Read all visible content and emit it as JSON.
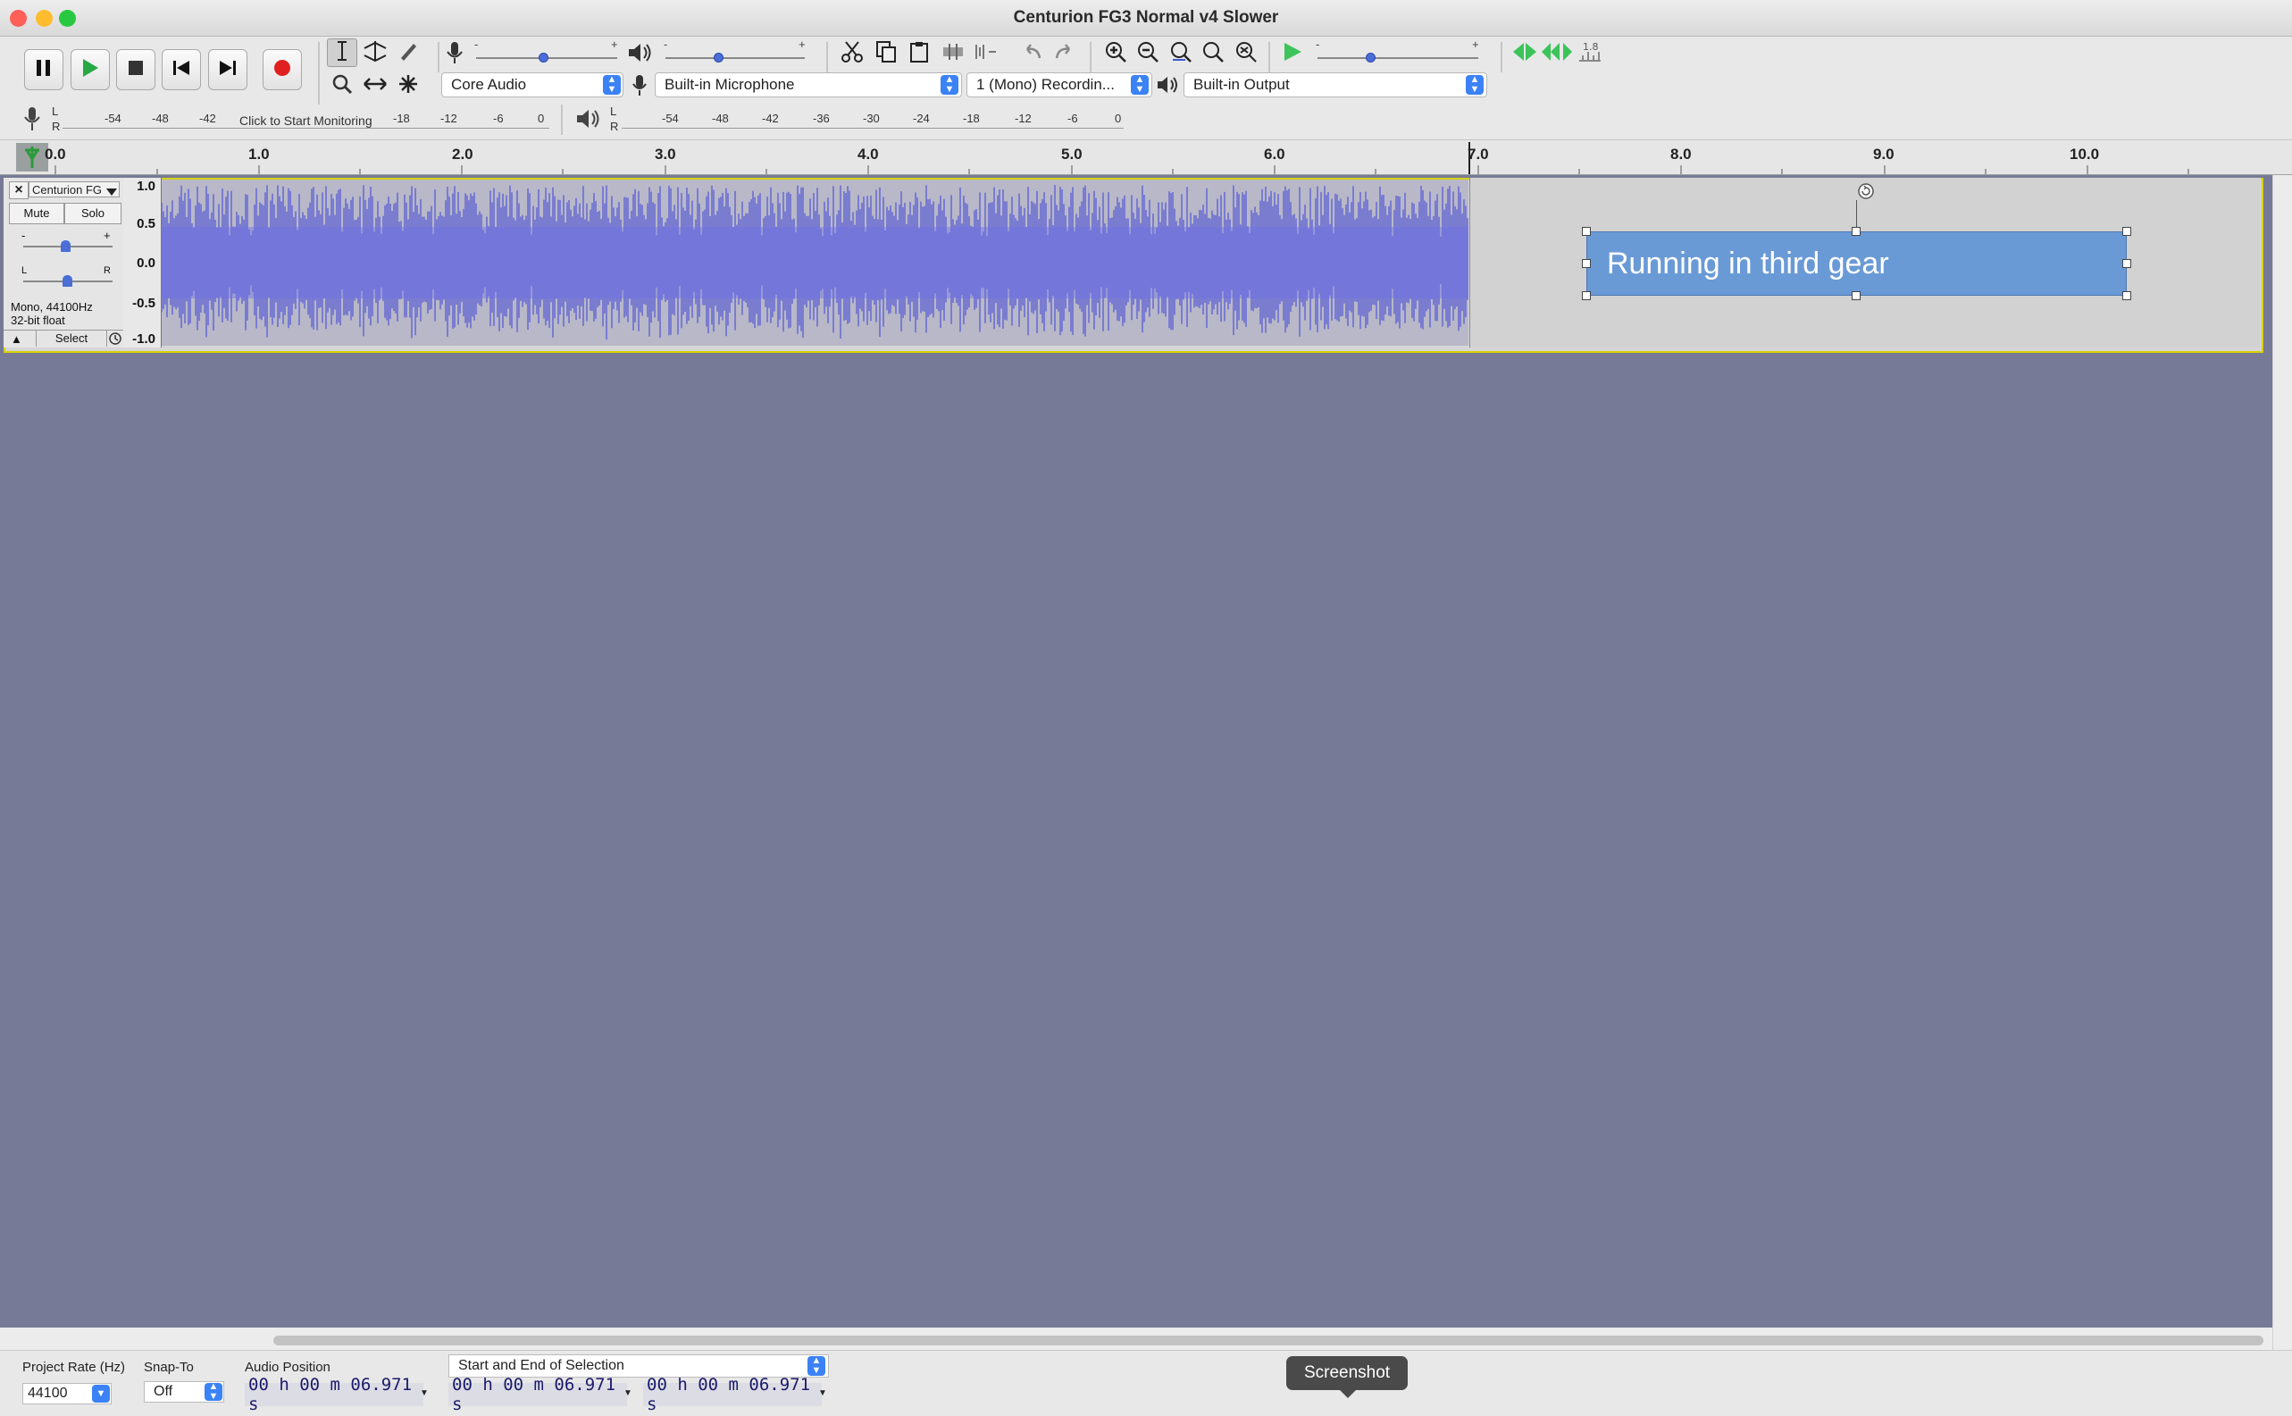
{
  "window": {
    "title": "Centurion FG3 Normal v4 Slower",
    "traffic_colors": {
      "close": "#fe5f57",
      "minimize": "#febc2e",
      "maximize": "#28c840"
    }
  },
  "toolbar": {
    "transport": [
      {
        "name": "pause-icon"
      },
      {
        "name": "play-icon"
      },
      {
        "name": "stop-icon"
      },
      {
        "name": "skip-to-start-icon"
      },
      {
        "name": "skip-to-end-icon"
      },
      {
        "name": "record-icon"
      }
    ],
    "tools": [
      "selection-tool-icon",
      "envelope-tool-icon",
      "draw-tool-icon",
      "zoom-tool-icon",
      "time-shift-tool-icon",
      "multi-tool-icon"
    ],
    "record_slider": {
      "min": "-",
      "max": "+",
      "level": 0.55
    },
    "playback_slider": {
      "min": "-",
      "max": "+",
      "level": 0.38
    },
    "play_at_speed_slider": {
      "min": "-",
      "max": "+",
      "level": 0.33
    },
    "edit_tools": [
      "cut-icon",
      "copy-icon",
      "paste-icon",
      "trim-icon",
      "silence-icon",
      "undo-icon",
      "redo-icon"
    ],
    "zoom_tools": [
      "zoom-in-icon",
      "zoom-out-icon",
      "fit-selection-icon",
      "fit-project-icon",
      "zoom-toggle-icon"
    ],
    "host": "Core Audio",
    "recording_device": "Built-in Microphone",
    "channels": "1 (Mono) Recordin...",
    "playback_device": "Built-in Output",
    "record_meter": {
      "lr": [
        "L",
        "R"
      ],
      "ticks": [
        "-54",
        "-48",
        "-42",
        "-18",
        "-12",
        "-6",
        "0"
      ],
      "monitor_text": "Click to Start Monitoring"
    },
    "playback_meter": {
      "lr": [
        "L",
        "R"
      ],
      "ticks": [
        "-54",
        "-48",
        "-42",
        "-36",
        "-30",
        "-24",
        "-18",
        "-12",
        "-6",
        "0"
      ]
    }
  },
  "ruler": {
    "labels": [
      "0.0",
      "1.0",
      "2.0",
      "3.0",
      "4.0",
      "5.0",
      "6.0",
      "7.0",
      "8.0",
      "9.0",
      "10.0"
    ]
  },
  "track": {
    "name": "Centurion FG",
    "close": "×",
    "mute": "Mute",
    "solo": "Solo",
    "gain_min": "-",
    "gain_max": "+",
    "pan_left": "L",
    "pan_right": "R",
    "format_line1": "Mono, 44100Hz",
    "format_line2": "32-bit float",
    "collapse": "▲",
    "select": "Select",
    "scale": [
      "1.0",
      "0.5",
      "0.0",
      "-0.5",
      "-1.0"
    ],
    "wave_color": "#3d3fd8",
    "selection_highlight": "#d8d100"
  },
  "label": {
    "text": "Running in third gear"
  },
  "bottom": {
    "project_rate_label": "Project Rate (Hz)",
    "project_rate_value": "44100",
    "snap_to_label": "Snap-To",
    "snap_to_value": "Off",
    "audio_position_label": "Audio Position",
    "audio_position_value": "00 h 00 m 06.971 s",
    "selection_mode": "Start and End of Selection",
    "selection_start": "00 h 00 m 06.971 s",
    "selection_end": "00 h 00 m 06.971 s",
    "tooltip": "Screenshot"
  }
}
